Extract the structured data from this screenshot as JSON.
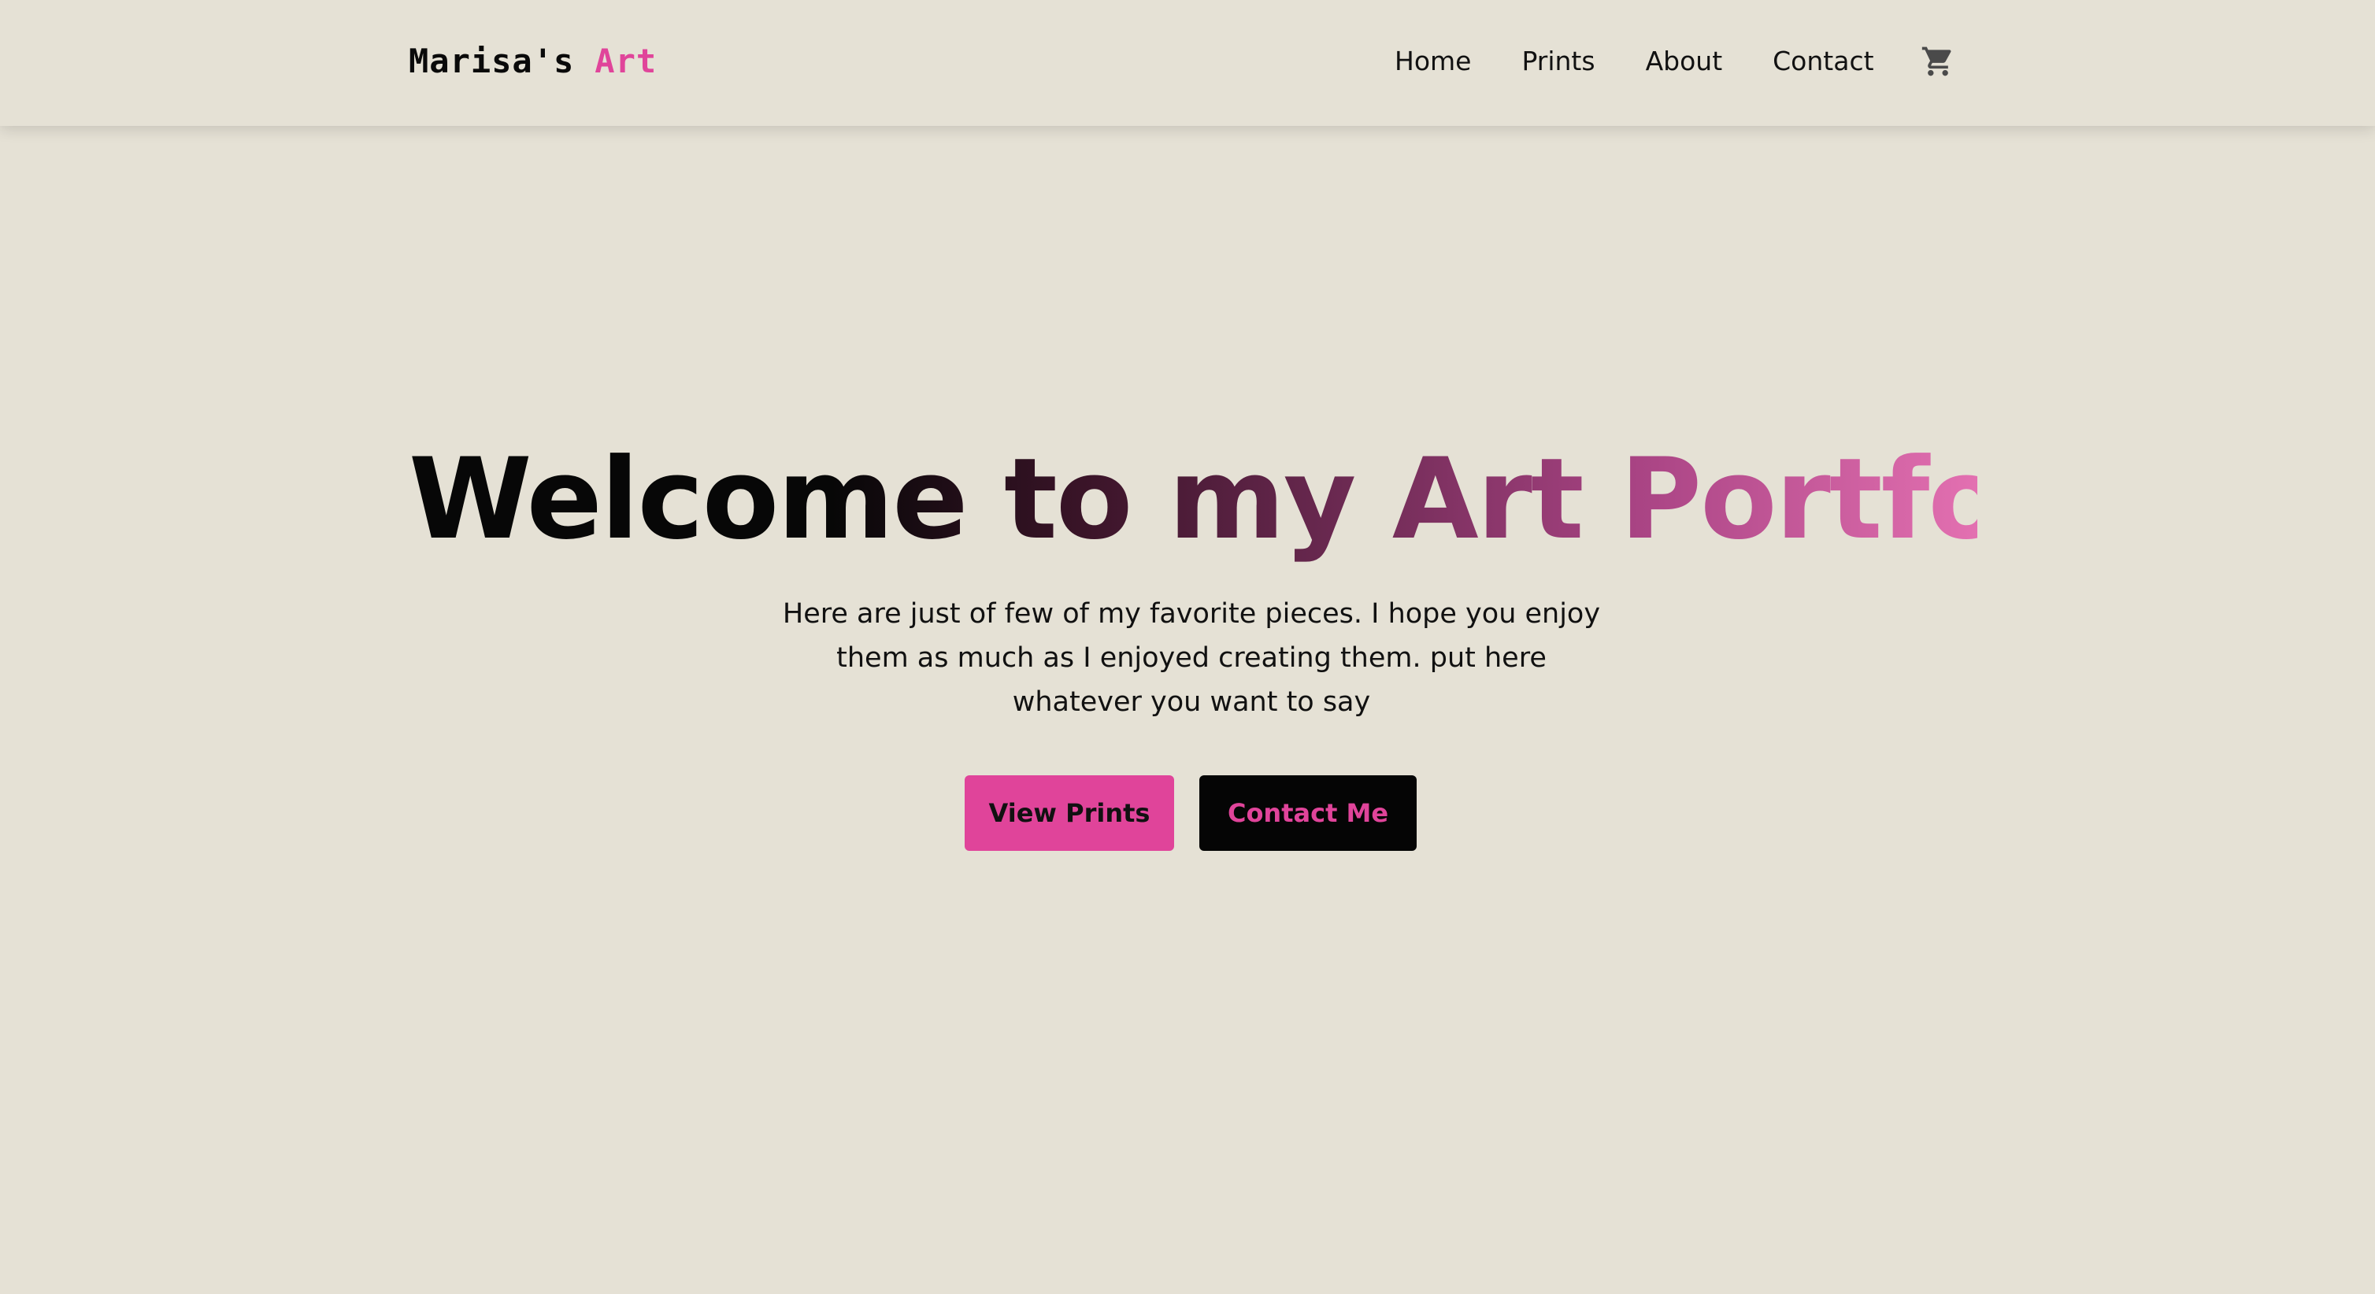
{
  "brand": {
    "name_first": "Marisa's",
    "name_second": "Art"
  },
  "nav": {
    "links": [
      "Home",
      "Prints",
      "About",
      "Contact"
    ],
    "cart_icon": "shopping-cart-icon"
  },
  "hero": {
    "title": "Welcome to my Art Portfolio!",
    "subtitle": "Here are just of few of my favorite pieces. I hope you enjoy\nthem as much as I enjoyed creating them. put here\nwhatever you want to say",
    "primary_button": "View Prints",
    "secondary_button": "Contact Me"
  },
  "colors": {
    "background": "#e5e1d5",
    "accent": "#e0449a",
    "text": "#0a0a0a",
    "button_dark": "#050505"
  }
}
